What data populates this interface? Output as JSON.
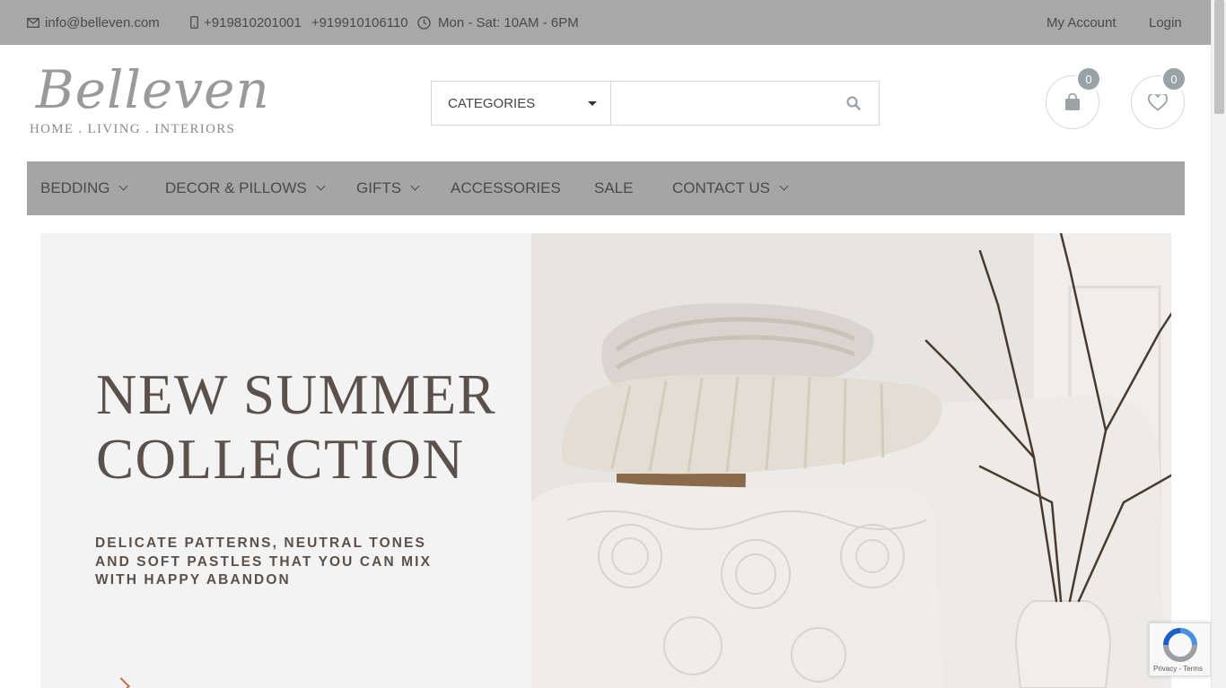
{
  "topbar": {
    "email": "info@belleven.com",
    "phone_1": "+919810201001",
    "phone_2": "+919910106110",
    "hours": "Mon - Sat: 10AM - 6PM",
    "my_account": "My Account",
    "login": "Login"
  },
  "brand": {
    "name": "Belleven",
    "tagline": "HOME . LIVING . INTERIORS"
  },
  "search": {
    "category_label": "CATEGORIES",
    "placeholder": "",
    "value": ""
  },
  "header_icons": {
    "cart_count": "0",
    "wishlist_count": "0"
  },
  "nav": {
    "items": [
      {
        "label": "BEDDING",
        "has_dropdown": true
      },
      {
        "label": "DECOR & PILLOWS",
        "has_dropdown": true
      },
      {
        "label": "GIFTS",
        "has_dropdown": true
      },
      {
        "label": "ACCESSORIES",
        "has_dropdown": false
      },
      {
        "label": "SALE",
        "has_dropdown": false
      },
      {
        "label": "CONTACT US",
        "has_dropdown": true
      }
    ]
  },
  "hero": {
    "title_line_1": "NEW SUMMER",
    "title_line_2": "COLLECTION",
    "subtitle_line_1": "DELICATE PATTERNS, NEUTRAL TONES",
    "subtitle_line_2": "AND SOFT PASTLES THAT YOU CAN MIX",
    "subtitle_line_3": "WITH HAPPY ABANDON"
  },
  "recaptcha": {
    "terms": "Privacy - Terms"
  },
  "colors": {
    "topbar_bg": "#a8a8a8",
    "nav_bg": "#a5a5a5",
    "badge_bg": "#97a3a6",
    "hero_text": "#5b504a",
    "hero_panel_bg": "#f3f3f3",
    "accent_arrow": "#c2704e"
  }
}
